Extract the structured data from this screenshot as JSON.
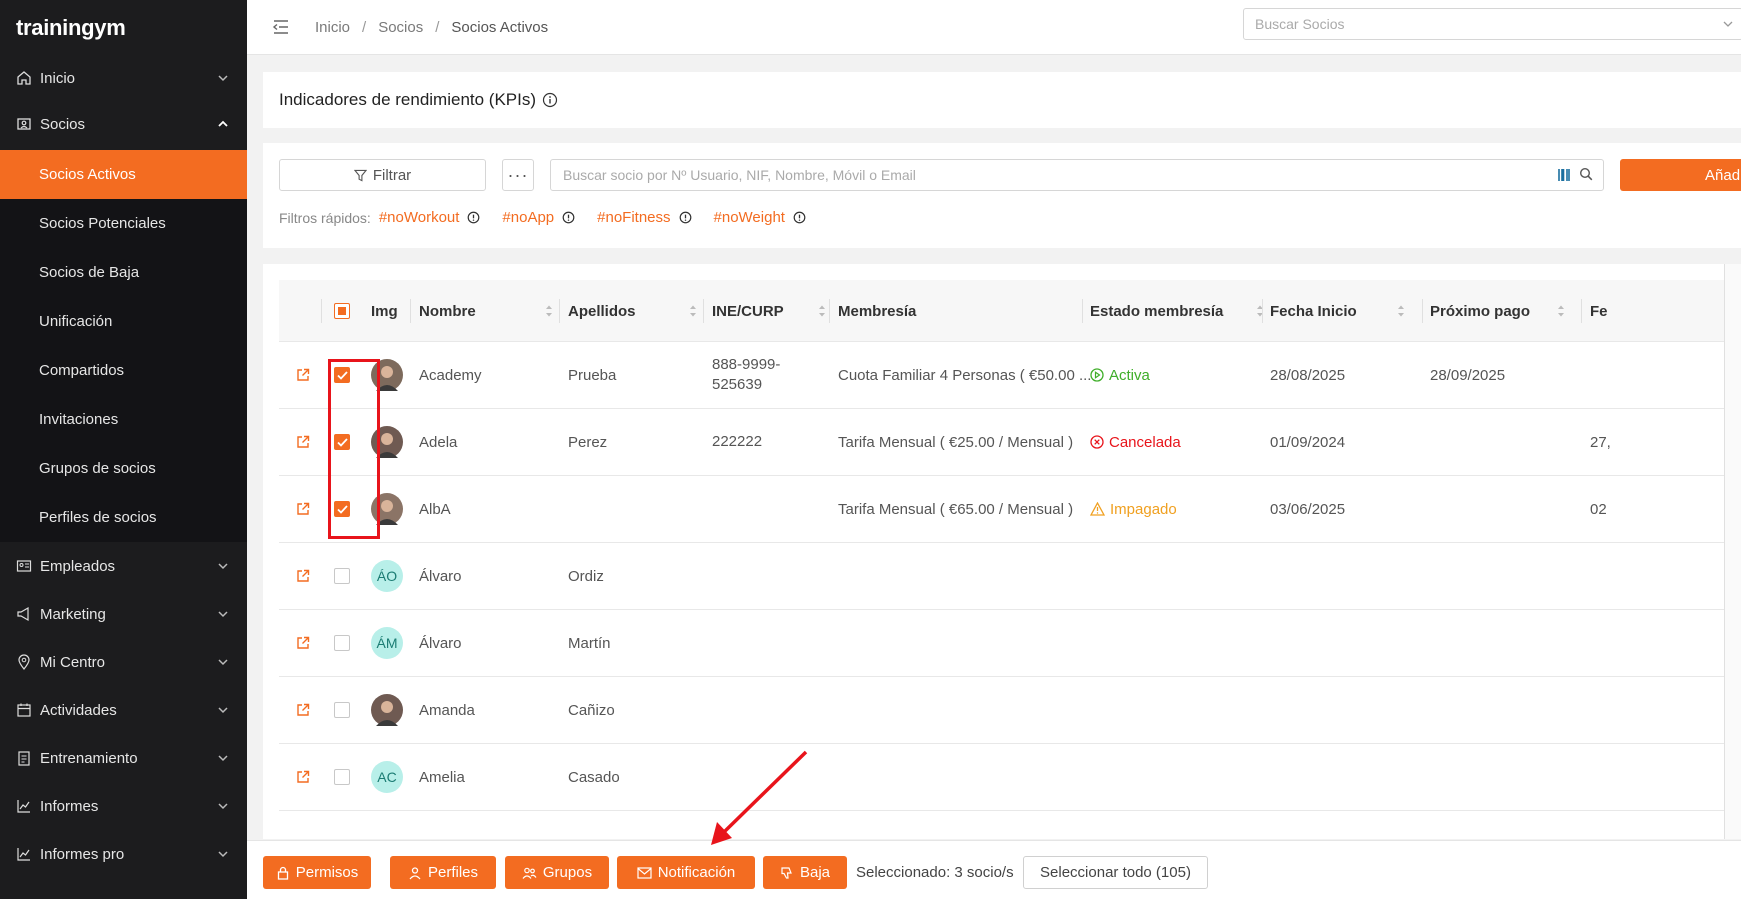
{
  "app": {
    "logo": "trainingym"
  },
  "sidebar": {
    "items": [
      {
        "label": "Inicio",
        "icon": "home-icon"
      },
      {
        "label": "Socios",
        "icon": "members-icon",
        "expanded": true
      },
      {
        "label": "Empleados",
        "icon": "id-card-icon"
      },
      {
        "label": "Marketing",
        "icon": "megaphone-icon"
      },
      {
        "label": "Mi Centro",
        "icon": "location-pin-icon"
      },
      {
        "label": "Actividades",
        "icon": "calendar-icon"
      },
      {
        "label": "Entrenamiento",
        "icon": "clipboard-icon"
      },
      {
        "label": "Informes",
        "icon": "chart-line-icon"
      },
      {
        "label": "Informes pro",
        "icon": "chart-line-icon"
      }
    ],
    "socios_sub": [
      "Socios Activos",
      "Socios Potenciales",
      "Socios de Baja",
      "Unificación",
      "Compartidos",
      "Invitaciones",
      "Grupos de socios",
      "Perfiles de socios"
    ],
    "active_sub": "Socios Activos"
  },
  "header": {
    "breadcrumb": [
      "Inicio",
      "Socios",
      "Socios Activos"
    ],
    "search_placeholder": "Buscar Socios"
  },
  "kpi": {
    "title": "Indicadores de rendimiento (KPIs)"
  },
  "filters": {
    "filter_label": "Filtrar",
    "more_label": "···",
    "search_placeholder": "Buscar socio por Nº Usuario, NIF, Nombre, Móvil o Email",
    "add_label": "Añadi",
    "quick_label": "Filtros rápidos:",
    "quick_tags": [
      "#noWorkout",
      "#noApp",
      "#noFitness",
      "#noWeight"
    ]
  },
  "table": {
    "columns": [
      "Img",
      "Nombre",
      "Apellidos",
      "INE/CURP",
      "Membresía",
      "Estado membresía",
      "Fecha Inicio",
      "Próximo pago",
      "Fe"
    ],
    "rows": [
      {
        "checked": true,
        "avatar": "photo",
        "initials": "",
        "nombre": "Academy",
        "apellidos": "Prueba",
        "ine": "888-9999-525639",
        "membresia": "Cuota Familiar 4 Personas ( €50.00 ...",
        "estado": "Activa",
        "estado_color": "#3fae29",
        "estado_icon": "play-circle-icon",
        "fecha_inicio": "28/08/2025",
        "proximo_pago": "28/09/2025",
        "fe": ""
      },
      {
        "checked": true,
        "avatar": "photo",
        "initials": "",
        "nombre": "Adela",
        "apellidos": "Perez",
        "ine": "222222",
        "membresia": "Tarifa Mensual ( €25.00 / Mensual )",
        "estado": "Cancelada",
        "estado_color": "#e8141b",
        "estado_icon": "x-circle-icon",
        "fecha_inicio": "01/09/2024",
        "proximo_pago": "",
        "fe": "27,"
      },
      {
        "checked": true,
        "avatar": "photo",
        "initials": "",
        "nombre": "AlbA",
        "apellidos": "",
        "ine": "",
        "membresia": "Tarifa Mensual ( €65.00 / Mensual )",
        "estado": "Impagado",
        "estado_color": "#f0a020",
        "estado_icon": "warning-triangle-icon",
        "fecha_inicio": "03/06/2025",
        "proximo_pago": "",
        "fe": "02"
      },
      {
        "checked": false,
        "avatar": "initials",
        "initials": "ÁO",
        "nombre": "Álvaro",
        "apellidos": "Ordiz",
        "ine": "",
        "membresia": "",
        "estado": "",
        "estado_color": "",
        "estado_icon": "",
        "fecha_inicio": "",
        "proximo_pago": "",
        "fe": ""
      },
      {
        "checked": false,
        "avatar": "initials",
        "initials": "ÁM",
        "nombre": "Álvaro",
        "apellidos": "Martín",
        "ine": "",
        "membresia": "",
        "estado": "",
        "estado_color": "",
        "estado_icon": "",
        "fecha_inicio": "",
        "proximo_pago": "",
        "fe": ""
      },
      {
        "checked": false,
        "avatar": "photo",
        "initials": "",
        "nombre": "Amanda",
        "apellidos": "Cañizo",
        "ine": "",
        "membresia": "",
        "estado": "",
        "estado_color": "",
        "estado_icon": "",
        "fecha_inicio": "",
        "proximo_pago": "",
        "fe": ""
      },
      {
        "checked": false,
        "avatar": "initials",
        "initials": "AC",
        "nombre": "Amelia",
        "apellidos": "Casado",
        "ine": "",
        "membresia": "",
        "estado": "",
        "estado_color": "",
        "estado_icon": "",
        "fecha_inicio": "",
        "proximo_pago": "",
        "fe": ""
      }
    ]
  },
  "bottom_bar": {
    "buttons": [
      {
        "label": "Permisos",
        "icon": "lock-icon"
      },
      {
        "label": "Perfiles",
        "icon": "user-icon"
      },
      {
        "label": "Grupos",
        "icon": "users-icon"
      },
      {
        "label": "Notificación",
        "icon": "envelope-icon"
      },
      {
        "label": "Baja",
        "icon": "thumbs-down-icon"
      }
    ],
    "selected_text": "Seleccionado: 3 socio/s",
    "select_all_label": "Seleccionar todo (105)"
  },
  "colors": {
    "accent": "#f36c21",
    "sidebar_bg": "#1c1c1e",
    "annotation_red": "#e8141b"
  }
}
